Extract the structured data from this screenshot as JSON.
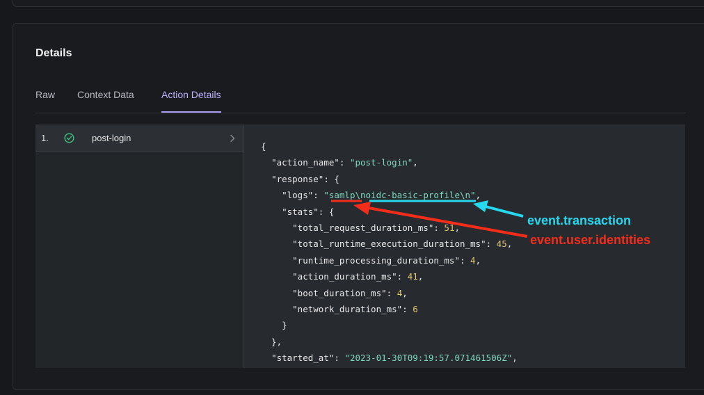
{
  "details": {
    "title": "Details"
  },
  "tabs": [
    {
      "label": "Raw",
      "active": false
    },
    {
      "label": "Context Data",
      "active": false
    },
    {
      "label": "Action Details",
      "active": true
    }
  ],
  "actions": [
    {
      "index": "1.",
      "name": "post-login",
      "status_icon": "check-circle-icon",
      "status_color": "#3dbb7f"
    }
  ],
  "code_lines": [
    [
      {
        "t": "p",
        "v": "{"
      }
    ],
    [
      {
        "t": "p",
        "v": "  "
      },
      {
        "t": "k",
        "v": "\"action_name\""
      },
      {
        "t": "p",
        "v": ": "
      },
      {
        "t": "s",
        "v": "\"post-login\""
      },
      {
        "t": "p",
        "v": ","
      }
    ],
    [
      {
        "t": "p",
        "v": "  "
      },
      {
        "t": "k",
        "v": "\"response\""
      },
      {
        "t": "p",
        "v": ": {"
      }
    ],
    [
      {
        "t": "p",
        "v": "    "
      },
      {
        "t": "k",
        "v": "\"logs\""
      },
      {
        "t": "p",
        "v": ": "
      },
      {
        "t": "s",
        "v": "\"samlp\\noidc-basic-profile\\n\""
      },
      {
        "t": "p",
        "v": ","
      }
    ],
    [
      {
        "t": "p",
        "v": "    "
      },
      {
        "t": "k",
        "v": "\"stats\""
      },
      {
        "t": "p",
        "v": ": {"
      }
    ],
    [
      {
        "t": "p",
        "v": "      "
      },
      {
        "t": "k",
        "v": "\"total_request_duration_ms\""
      },
      {
        "t": "p",
        "v": ": "
      },
      {
        "t": "n",
        "v": "51"
      },
      {
        "t": "p",
        "v": ","
      }
    ],
    [
      {
        "t": "p",
        "v": "      "
      },
      {
        "t": "k",
        "v": "\"total_runtime_execution_duration_ms\""
      },
      {
        "t": "p",
        "v": ": "
      },
      {
        "t": "n",
        "v": "45"
      },
      {
        "t": "p",
        "v": ","
      }
    ],
    [
      {
        "t": "p",
        "v": "      "
      },
      {
        "t": "k",
        "v": "\"runtime_processing_duration_ms\""
      },
      {
        "t": "p",
        "v": ": "
      },
      {
        "t": "n",
        "v": "4"
      },
      {
        "t": "p",
        "v": ","
      }
    ],
    [
      {
        "t": "p",
        "v": "      "
      },
      {
        "t": "k",
        "v": "\"action_duration_ms\""
      },
      {
        "t": "p",
        "v": ": "
      },
      {
        "t": "n",
        "v": "41"
      },
      {
        "t": "p",
        "v": ","
      }
    ],
    [
      {
        "t": "p",
        "v": "      "
      },
      {
        "t": "k",
        "v": "\"boot_duration_ms\""
      },
      {
        "t": "p",
        "v": ": "
      },
      {
        "t": "n",
        "v": "4"
      },
      {
        "t": "p",
        "v": ","
      }
    ],
    [
      {
        "t": "p",
        "v": "      "
      },
      {
        "t": "k",
        "v": "\"network_duration_ms\""
      },
      {
        "t": "p",
        "v": ": "
      },
      {
        "t": "n",
        "v": "6"
      }
    ],
    [
      {
        "t": "p",
        "v": "    }"
      }
    ],
    [
      {
        "t": "p",
        "v": "  },"
      }
    ],
    [
      {
        "t": "p",
        "v": "  "
      },
      {
        "t": "k",
        "v": "\"started_at\""
      },
      {
        "t": "p",
        "v": ": "
      },
      {
        "t": "s",
        "v": "\"2023-01-30T09:19:57.071461506Z\""
      },
      {
        "t": "p",
        "v": ","
      }
    ]
  ],
  "annotations": {
    "transaction": {
      "label": "event.transaction",
      "color": "#27d9ee"
    },
    "identities": {
      "label": "event.user.identities",
      "color": "#f22d1a"
    }
  }
}
